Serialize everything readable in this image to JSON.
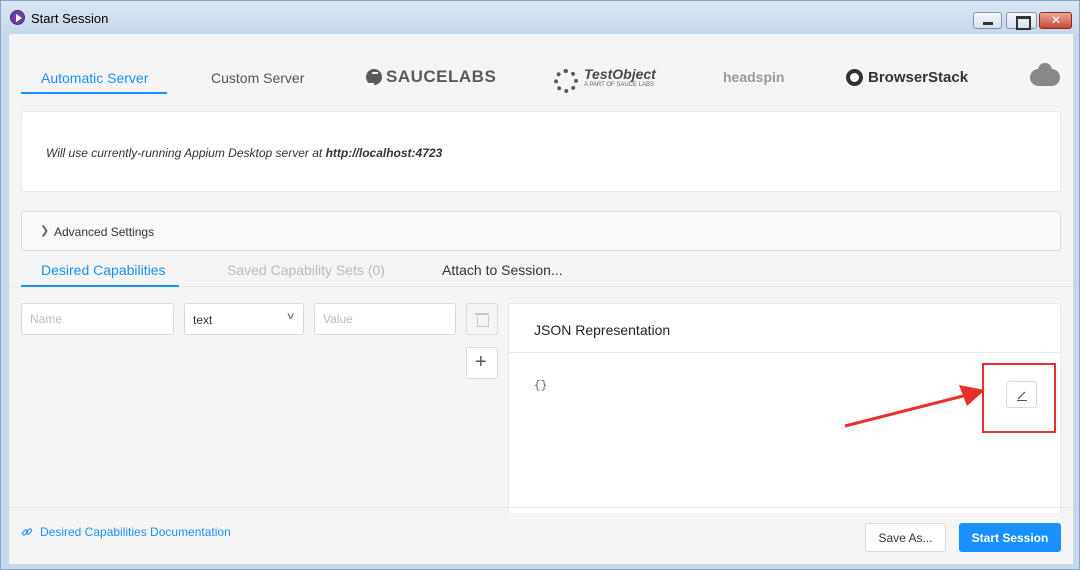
{
  "window": {
    "title": "Start Session"
  },
  "server_tabs": {
    "automatic": "Automatic Server",
    "custom": "Custom Server",
    "saucelabs": "SAUCELABS",
    "testobject": "TestObject",
    "testobject_sub": "A PART OF SAUCE LABS",
    "headspin": "headspin",
    "browserstack": "BrowserStack",
    "icons": [
      "saucelabs-logo-icon",
      "testobject-gear-icon",
      "browserstack-eye-icon",
      "cloud-key-icon"
    ]
  },
  "info": {
    "prefix": "Will use currently-running Appium Desktop server at ",
    "url": "http://localhost:4723"
  },
  "advanced": {
    "label": "Advanced Settings"
  },
  "capability_tabs": {
    "desired": "Desired Capabilities",
    "saved": "Saved Capability Sets (0)",
    "attach": "Attach to Session..."
  },
  "capability_form": {
    "name_placeholder": "Name",
    "type_value": "text",
    "value_placeholder": "Value"
  },
  "json_panel": {
    "title": "JSON Representation",
    "content": "{}"
  },
  "footer": {
    "doc_link": "Desired Capabilities Documentation",
    "save_as": "Save As...",
    "start_session": "Start Session"
  },
  "colors": {
    "accent": "#1890ff",
    "annotation": "#e8312d"
  }
}
